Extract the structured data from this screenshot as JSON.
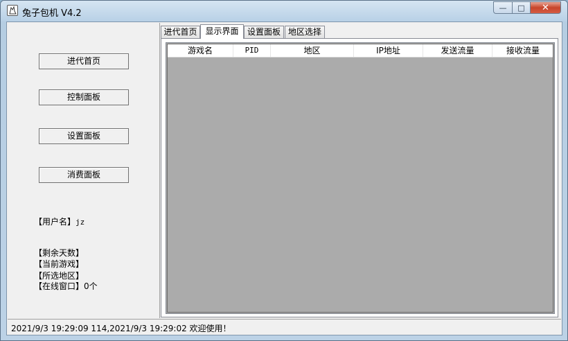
{
  "window": {
    "title": "兔子包机 V4.2"
  },
  "sidebar": {
    "buttons": [
      {
        "label": "进代首页"
      },
      {
        "label": "控制面板"
      },
      {
        "label": "设置面板"
      },
      {
        "label": "消费面板"
      }
    ],
    "info": {
      "username_label": "【用户名】",
      "username_value": "jz",
      "days_label": "【剩余天数】",
      "game_label": "【当前游戏】",
      "region_label": "【所选地区】",
      "online_label": "【在线窗口】",
      "online_value": "0个"
    }
  },
  "tabs": [
    {
      "label": "进代首页"
    },
    {
      "label": "显示界面",
      "active": true
    },
    {
      "label": "设置面板"
    },
    {
      "label": "地区选择"
    }
  ],
  "table": {
    "columns": [
      "游戏名",
      "PID",
      "地区",
      "IP地址",
      "发送流量",
      "接收流量"
    ],
    "rows": []
  },
  "status": {
    "text": "2021/9/3 19:29:09  114,2021/9/3 19:29:02  欢迎使用！"
  }
}
